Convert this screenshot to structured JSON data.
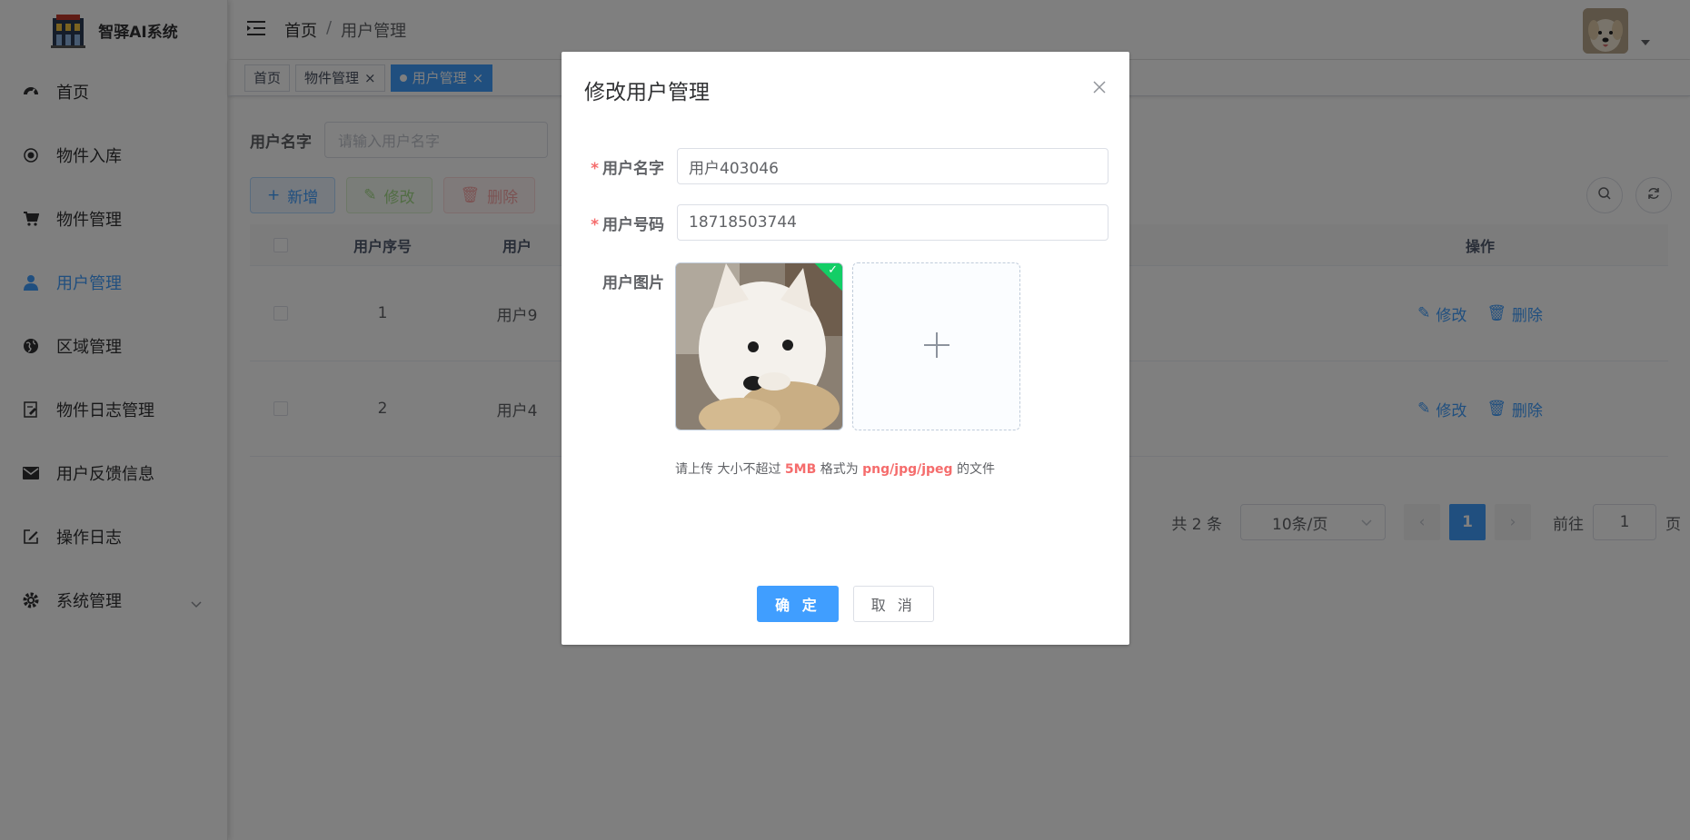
{
  "app": {
    "title": "智驿AI系统"
  },
  "sidebar": {
    "items": [
      {
        "label": "首页",
        "icon": "dashboard-icon"
      },
      {
        "label": "物件入库",
        "icon": "radio-dot-icon"
      },
      {
        "label": "物件管理",
        "icon": "cart-icon"
      },
      {
        "label": "用户管理",
        "icon": "user-icon",
        "active": true
      },
      {
        "label": "区域管理",
        "icon": "globe-icon"
      },
      {
        "label": "物件日志管理",
        "icon": "document-edit-icon"
      },
      {
        "label": "用户反馈信息",
        "icon": "mail-icon"
      },
      {
        "label": "操作日志",
        "icon": "edit-icon"
      },
      {
        "label": "系统管理",
        "icon": "gear-icon"
      }
    ]
  },
  "header": {
    "breadcrumb": [
      "首页",
      "/",
      "用户管理"
    ]
  },
  "tags": [
    {
      "label": "首页"
    },
    {
      "label": "物件管理"
    },
    {
      "label": "用户管理",
      "active": true
    }
  ],
  "search": {
    "label": "用户名字",
    "placeholder": "请输入用户名字"
  },
  "toolbar": {
    "add": "新增",
    "edit": "修改",
    "delete": "删除"
  },
  "table": {
    "headers": {
      "index": "用户序号",
      "name": "用户",
      "op": "操作"
    },
    "rows": [
      {
        "index": "1",
        "name": "用户9"
      },
      {
        "index": "2",
        "name": "用户4"
      }
    ],
    "op_edit": "修改",
    "op_delete": "删除"
  },
  "pager": {
    "total": "共 2 条",
    "page_size": "10条/页",
    "current": "1",
    "goto_label": "前往",
    "goto_value": "1",
    "page_suffix": "页"
  },
  "dialog": {
    "title": "修改用户管理",
    "fields": {
      "name_label": "用户名字",
      "name_value": "用户403046",
      "phone_label": "用户号码",
      "phone_value": "18718503744",
      "image_label": "用户图片"
    },
    "required_mark": "*",
    "tip": {
      "prefix": "请上传 大小不超过 ",
      "size": "5MB",
      "mid": " 格式为 ",
      "formats": "png/jpg/jpeg",
      "suffix": " 的文件"
    },
    "confirm": "确 定",
    "cancel": "取 消"
  },
  "colors": {
    "primary": "#409eff",
    "success": "#67c23a",
    "danger": "#f56c6c",
    "upload_badge": "#13ce66"
  }
}
